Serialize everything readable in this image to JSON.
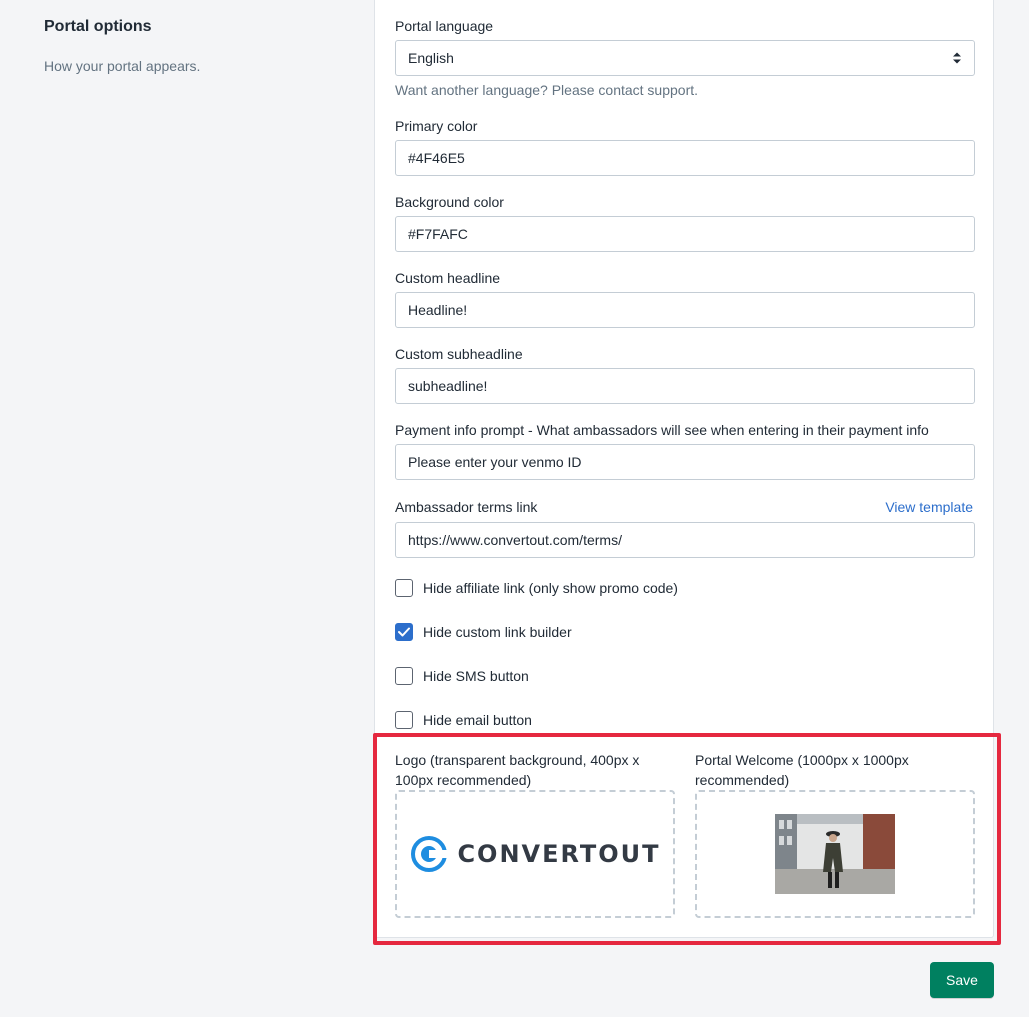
{
  "section": {
    "title": "Portal options",
    "description": "How your portal appears."
  },
  "form": {
    "language": {
      "label": "Portal language",
      "value": "English",
      "help": "Want another language? Please contact support."
    },
    "primary_color": {
      "label": "Primary color",
      "value": "#4F46E5"
    },
    "background_color": {
      "label": "Background color",
      "value": "#F7FAFC"
    },
    "headline": {
      "label": "Custom headline",
      "value": "Headline!"
    },
    "subheadline": {
      "label": "Custom subheadline",
      "value": "subheadline!"
    },
    "payment_prompt": {
      "label": "Payment info prompt - What ambassadors will see when entering in their payment info",
      "value": "Please enter your venmo ID"
    },
    "terms": {
      "label": "Ambassador terms link",
      "link": "View template",
      "value": "https://www.convertout.com/terms/"
    },
    "checkboxes": [
      {
        "label": "Hide affiliate link (only show promo code)",
        "checked": false
      },
      {
        "label": "Hide custom link builder",
        "checked": true
      },
      {
        "label": "Hide SMS button",
        "checked": false
      },
      {
        "label": "Hide email button",
        "checked": false
      }
    ],
    "uploads": {
      "logo": {
        "label": "Logo (transparent background, 400px x 100px recommended)",
        "logo_text": "CONVERTOUT"
      },
      "welcome": {
        "label": "Portal Welcome (1000px x 1000px recommended)"
      }
    }
  },
  "actions": {
    "save_label": "Save"
  },
  "colors": {
    "accent": "#2c6ecb",
    "save_button": "#008060",
    "highlight": "#e5283f"
  }
}
